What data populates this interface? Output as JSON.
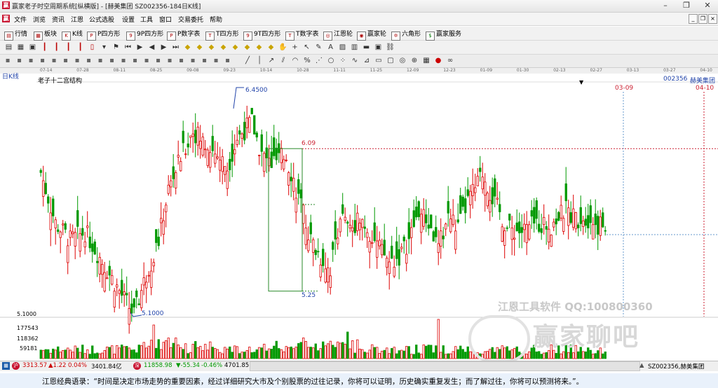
{
  "window": {
    "title": "赢家老子时空周期系统[纵横版] - [赫美集团  SZ002356-184日K线]",
    "controls": [
      "–",
      "❐",
      "✕"
    ]
  },
  "menu": {
    "items": [
      "文件",
      "浏览",
      "资讯",
      "江恩",
      "公式选股",
      "设置",
      "工具",
      "窗口",
      "交易委托",
      "帮助"
    ],
    "mdi_controls": [
      "_",
      "❐",
      "×"
    ]
  },
  "toolbar_main": {
    "items": [
      "行情",
      "板块",
      "K线",
      "P四方形",
      "9P四方形",
      "P数字表",
      "T四方形",
      "9T四方形",
      "T数字表",
      "江恩轮",
      "赢家轮",
      "六角形",
      "赢家服务"
    ]
  },
  "toolbar_tools": {
    "icons": [
      "menu-icon",
      "grid-icon",
      "calc-icon",
      "bar-icon",
      "bar-icon",
      "bar-icon",
      "bar-icon",
      "candle-icon",
      "dropdown-icon",
      "flag-icon",
      "first-icon",
      "play-icon",
      "prev-icon",
      "next-icon",
      "last-icon",
      "zoom-icon",
      "zoom-icon",
      "zoom-icon",
      "zoom-icon",
      "zoom-icon",
      "zoom-icon",
      "zoom-icon",
      "zoom-icon",
      "hand-icon",
      "cross-icon",
      "pointer-icon",
      "note-icon",
      "text-icon",
      "picture-icon",
      "calendar-icon",
      "folder-icon",
      "save-icon",
      "link-icon"
    ]
  },
  "toolbar_draw": {
    "icons": [
      "line-icon",
      "vline-icon",
      "ray-icon",
      "channel-icon",
      "arc-icon",
      "pct-icon",
      "fan-icon",
      "circle-icon",
      "dots-icon",
      "wave-icon",
      "gann-icon",
      "ruler-icon",
      "box-icon",
      "spiral-icon",
      "cycle-icon",
      "table-icon",
      "color-icon",
      "loop-icon"
    ]
  },
  "chart": {
    "period_label": "日K线",
    "study_name": "老子十二宫结构",
    "stock_name": "赫美集团",
    "stock_code": "002356",
    "date_axis": [
      "07-14",
      "07-28",
      "08-11",
      "08-25",
      "09-08",
      "09-23",
      "10-14",
      "10-28",
      "11-11",
      "11-25",
      "12-09",
      "12-23",
      "01-09",
      "01-30",
      "02-13",
      "02-27",
      "03-13",
      "03-27",
      "04-10"
    ],
    "price_axis": [
      "5.1000"
    ],
    "volume_axis": [
      "177543",
      "118362",
      "59181"
    ],
    "annotations": {
      "high": "6.4500",
      "low": "5.1000",
      "box_top": "6.09",
      "box_bottom": "5.25",
      "date_a": "03-09",
      "date_b": "04-10"
    },
    "watermark_tool": "江恩工具软件  QQ:100800360",
    "watermark_brand": "赢家聊吧"
  },
  "chart_data": {
    "type": "candlestick",
    "title": "赫美集团 002356 日K线",
    "y_range": [
      5.1,
      6.45
    ],
    "key_levels": {
      "high": 6.45,
      "low": 5.1,
      "box_top": 6.09,
      "box_bottom": 5.25
    },
    "colors": {
      "up": "#dd0000",
      "down": "#009900"
    }
  },
  "status": {
    "sh_index": "3313.57",
    "sh_change": "▲1.22",
    "sh_pct": "0.04%",
    "sh_amount": "3401.84亿",
    "sz_index": "11858.98",
    "sz_change": "▼-55.34",
    "sz_pct": "-0.46%",
    "sz_amount": "4701.85",
    "current_stock": "SZ002356,赫美集团"
  },
  "quote": {
    "text": "江恩经典语录：“时间是决定市场走势的重要因素，经过详细研究大市及个别股票的过往记录，你将可以证明，历史确实重复发生；而了解过往，你将可以预测将来。”。"
  },
  "colors": {
    "up": "#dd0000",
    "down": "#009900",
    "axis": "#666666",
    "annotation": "#cc2233",
    "link": "#2244aa"
  }
}
